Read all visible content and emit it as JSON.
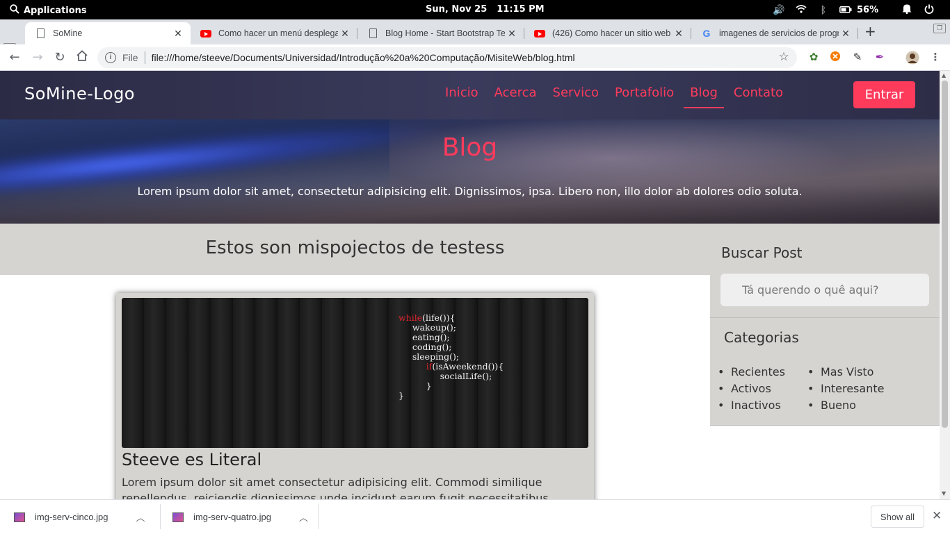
{
  "system_bar": {
    "applications": "Applications",
    "date": "Sun, Nov 25",
    "time": "11:15 PM",
    "battery": "56%"
  },
  "tabs": [
    {
      "title": "SoMine",
      "icon": "document-icon",
      "active": true
    },
    {
      "title": "Como hacer un menú desplega",
      "icon": "youtube-icon",
      "active": false
    },
    {
      "title": "Blog Home - Start Bootstrap Te",
      "icon": "document-icon",
      "active": false
    },
    {
      "title": "(426) Como hacer un sitio web",
      "icon": "youtube-icon",
      "active": false
    },
    {
      "title": "imagenes de servicios de progr",
      "icon": "google-icon",
      "active": false
    }
  ],
  "address_bar": {
    "scheme_label": "File",
    "url": "file:///home/steeve/Documents/Universidad/Introdução%20a%20Computação/MisiteWeb/blog.html"
  },
  "site": {
    "logo": "SoMine-Logo",
    "menu": [
      "Inicio",
      "Acerca",
      "Servico",
      "Portafolio",
      "Blog",
      "Contato"
    ],
    "active_menu": "Blog",
    "login_button": "Entrar",
    "hero_title": "Blog",
    "hero_text": "Lorem ipsum dolor sit amet, consectetur adipisicing elit. Dignissimos, ipsa. Libero non, illo dolor ab dolores odio soluta.",
    "section_title": "Estos son mispojectos de testess",
    "post": {
      "code_lines": [
        "while(life()){",
        "wakeup();",
        "eating();",
        "coding();",
        "sleeping();",
        "if(isAweekend()){",
        "socialLife();",
        "}",
        "}"
      ],
      "title": "Steeve es Literal",
      "excerpt": "Lorem ipsum dolor sit amet consectetur adipisicing elit. Commodi similique repellendus, reiciendis dignissimos unde incidunt earum fugit necessitatibus"
    },
    "sidebar": {
      "search_title": "Buscar Post",
      "search_placeholder": "Tá querendo o quê aqui?",
      "categories_title": "Categorias",
      "categories": [
        "Recientes",
        "Mas Visto",
        "Activos",
        "Interesante",
        "Inactivos",
        "Bueno"
      ]
    }
  },
  "downloads": {
    "items": [
      "img-serv-cinco.jpg",
      "img-serv-quatro.jpg"
    ],
    "show_all": "Show all"
  },
  "colors": {
    "accent": "#ff3b5c",
    "navbar": "#2b2b45",
    "panel": "#d6d4d1"
  }
}
